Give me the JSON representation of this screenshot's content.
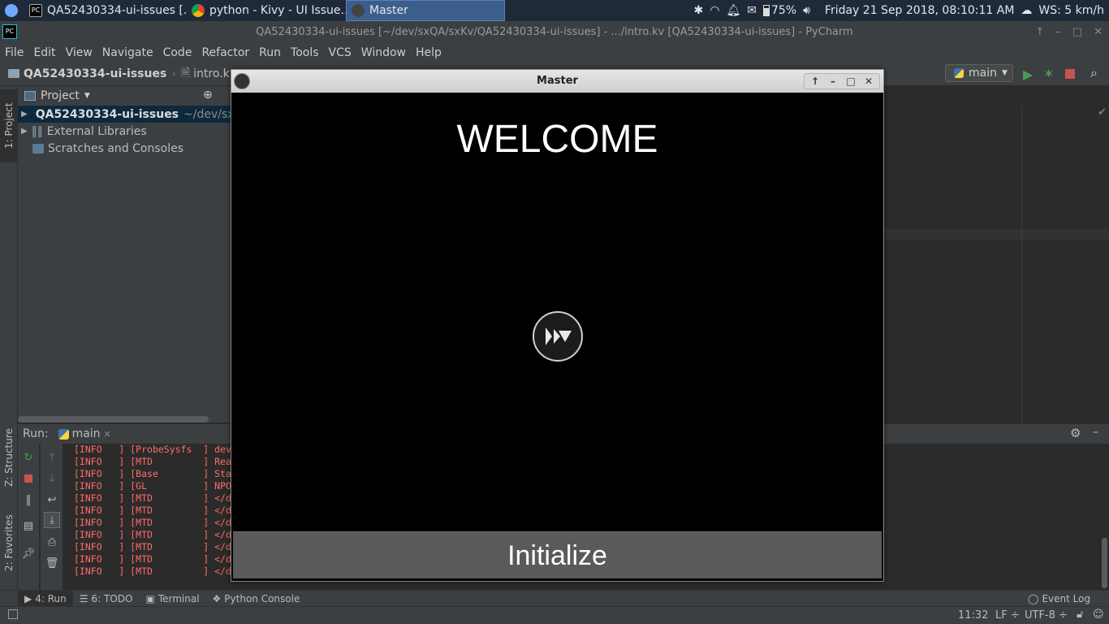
{
  "taskbar": {
    "tasks": [
      {
        "label": "QA52430334-ui-issues [..."
      },
      {
        "label": "python - Kivy - UI Issue..."
      },
      {
        "label": "Master"
      }
    ],
    "battery": "75%",
    "datetime": "Friday 21 Sep 2018, 08:10:11 AM",
    "weather": "WS: 5 km/h"
  },
  "pycharm": {
    "title": "QA52430334-ui-issues [~/dev/sxQA/sxKv/QA52430334-ui-issues] - .../intro.kv [QA52430334-ui-issues] - PyCharm",
    "menu": [
      "File",
      "Edit",
      "View",
      "Navigate",
      "Code",
      "Refactor",
      "Run",
      "Tools",
      "VCS",
      "Window",
      "Help"
    ],
    "breadcrumb": {
      "project": "QA52430334-ui-issues",
      "file": "intro.kv"
    },
    "run_config": "main",
    "left_tabs": {
      "project": "1: Project",
      "structure": "Z: Structure",
      "favorites": "2: Favorites"
    },
    "project_panel": {
      "header": "Project",
      "items": [
        {
          "label": "QA52430334-ui-issues",
          "path": "~/dev/sx"
        },
        {
          "label": "External Libraries"
        },
        {
          "label": "Scratches and Consoles"
        }
      ]
    },
    "run_panel": {
      "label": "Run:",
      "tab": "main",
      "log": [
        {
          "level": "[INFO   ]",
          "tag": "[ProbeSysfs  ]",
          "msg": "dev"
        },
        {
          "level": "[INFO   ]",
          "tag": "[MTD         ]",
          "msg": "Rea"
        },
        {
          "level": "[INFO   ]",
          "tag": "[Base        ]",
          "msg": "Sta"
        },
        {
          "level": "[INFO   ]",
          "tag": "[GL          ]",
          "msg": "NPO"
        },
        {
          "level": "[INFO   ]",
          "tag": "[MTD         ]",
          "msg": "</d"
        },
        {
          "level": "[INFO   ]",
          "tag": "[MTD         ]",
          "msg": "</d"
        },
        {
          "level": "[INFO   ]",
          "tag": "[MTD         ]",
          "msg": "</d"
        },
        {
          "level": "[INFO   ]",
          "tag": "[MTD         ]",
          "msg": "</d"
        },
        {
          "level": "[INFO   ]",
          "tag": "[MTD         ]",
          "msg": "</d"
        },
        {
          "level": "[INFO   ]",
          "tag": "[MTD         ]",
          "msg": "</d"
        },
        {
          "level": "[INFO   ]",
          "tag": "[MTD         ]",
          "msg": "</d"
        }
      ]
    },
    "tool_windows": {
      "run": "4: Run",
      "todo": "6: TODO",
      "terminal": "Terminal",
      "python_console": "Python Console",
      "event_log": "Event Log"
    },
    "status": {
      "position": "11:32",
      "line_sep": "LF ÷",
      "encoding": "UTF-8 ÷"
    }
  },
  "kivy": {
    "title": "Master",
    "welcome": "WELCOME",
    "button": "Initialize"
  },
  "colors": {
    "log_text": "#ff6b68",
    "ide_bg": "#2b2b2b",
    "panel_bg": "#3c3f41",
    "run_green": "#499c54",
    "stop_red": "#c75450"
  }
}
